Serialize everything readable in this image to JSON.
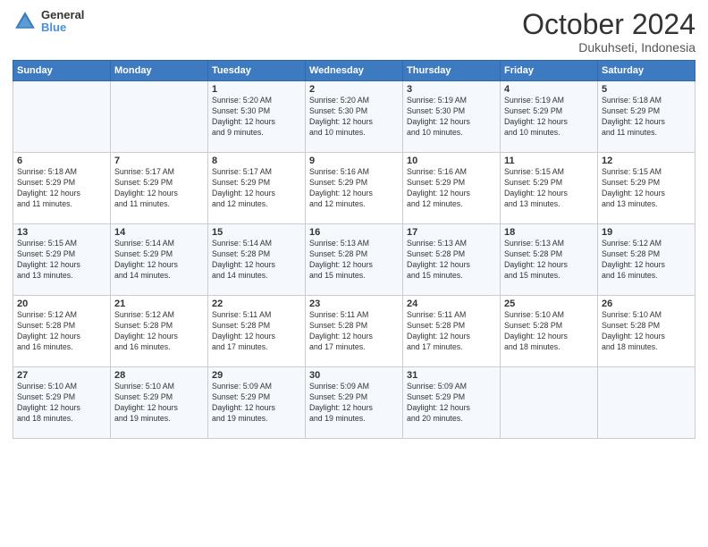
{
  "logo": {
    "line1": "General",
    "line2": "Blue"
  },
  "title": "October 2024",
  "subtitle": "Dukuhseti, Indonesia",
  "header_days": [
    "Sunday",
    "Monday",
    "Tuesday",
    "Wednesday",
    "Thursday",
    "Friday",
    "Saturday"
  ],
  "weeks": [
    [
      {
        "day": "",
        "info": ""
      },
      {
        "day": "",
        "info": ""
      },
      {
        "day": "1",
        "info": "Sunrise: 5:20 AM\nSunset: 5:30 PM\nDaylight: 12 hours\nand 9 minutes."
      },
      {
        "day": "2",
        "info": "Sunrise: 5:20 AM\nSunset: 5:30 PM\nDaylight: 12 hours\nand 10 minutes."
      },
      {
        "day": "3",
        "info": "Sunrise: 5:19 AM\nSunset: 5:30 PM\nDaylight: 12 hours\nand 10 minutes."
      },
      {
        "day": "4",
        "info": "Sunrise: 5:19 AM\nSunset: 5:29 PM\nDaylight: 12 hours\nand 10 minutes."
      },
      {
        "day": "5",
        "info": "Sunrise: 5:18 AM\nSunset: 5:29 PM\nDaylight: 12 hours\nand 11 minutes."
      }
    ],
    [
      {
        "day": "6",
        "info": "Sunrise: 5:18 AM\nSunset: 5:29 PM\nDaylight: 12 hours\nand 11 minutes."
      },
      {
        "day": "7",
        "info": "Sunrise: 5:17 AM\nSunset: 5:29 PM\nDaylight: 12 hours\nand 11 minutes."
      },
      {
        "day": "8",
        "info": "Sunrise: 5:17 AM\nSunset: 5:29 PM\nDaylight: 12 hours\nand 12 minutes."
      },
      {
        "day": "9",
        "info": "Sunrise: 5:16 AM\nSunset: 5:29 PM\nDaylight: 12 hours\nand 12 minutes."
      },
      {
        "day": "10",
        "info": "Sunrise: 5:16 AM\nSunset: 5:29 PM\nDaylight: 12 hours\nand 12 minutes."
      },
      {
        "day": "11",
        "info": "Sunrise: 5:15 AM\nSunset: 5:29 PM\nDaylight: 12 hours\nand 13 minutes."
      },
      {
        "day": "12",
        "info": "Sunrise: 5:15 AM\nSunset: 5:29 PM\nDaylight: 12 hours\nand 13 minutes."
      }
    ],
    [
      {
        "day": "13",
        "info": "Sunrise: 5:15 AM\nSunset: 5:29 PM\nDaylight: 12 hours\nand 13 minutes."
      },
      {
        "day": "14",
        "info": "Sunrise: 5:14 AM\nSunset: 5:29 PM\nDaylight: 12 hours\nand 14 minutes."
      },
      {
        "day": "15",
        "info": "Sunrise: 5:14 AM\nSunset: 5:28 PM\nDaylight: 12 hours\nand 14 minutes."
      },
      {
        "day": "16",
        "info": "Sunrise: 5:13 AM\nSunset: 5:28 PM\nDaylight: 12 hours\nand 15 minutes."
      },
      {
        "day": "17",
        "info": "Sunrise: 5:13 AM\nSunset: 5:28 PM\nDaylight: 12 hours\nand 15 minutes."
      },
      {
        "day": "18",
        "info": "Sunrise: 5:13 AM\nSunset: 5:28 PM\nDaylight: 12 hours\nand 15 minutes."
      },
      {
        "day": "19",
        "info": "Sunrise: 5:12 AM\nSunset: 5:28 PM\nDaylight: 12 hours\nand 16 minutes."
      }
    ],
    [
      {
        "day": "20",
        "info": "Sunrise: 5:12 AM\nSunset: 5:28 PM\nDaylight: 12 hours\nand 16 minutes."
      },
      {
        "day": "21",
        "info": "Sunrise: 5:12 AM\nSunset: 5:28 PM\nDaylight: 12 hours\nand 16 minutes."
      },
      {
        "day": "22",
        "info": "Sunrise: 5:11 AM\nSunset: 5:28 PM\nDaylight: 12 hours\nand 17 minutes."
      },
      {
        "day": "23",
        "info": "Sunrise: 5:11 AM\nSunset: 5:28 PM\nDaylight: 12 hours\nand 17 minutes."
      },
      {
        "day": "24",
        "info": "Sunrise: 5:11 AM\nSunset: 5:28 PM\nDaylight: 12 hours\nand 17 minutes."
      },
      {
        "day": "25",
        "info": "Sunrise: 5:10 AM\nSunset: 5:28 PM\nDaylight: 12 hours\nand 18 minutes."
      },
      {
        "day": "26",
        "info": "Sunrise: 5:10 AM\nSunset: 5:28 PM\nDaylight: 12 hours\nand 18 minutes."
      }
    ],
    [
      {
        "day": "27",
        "info": "Sunrise: 5:10 AM\nSunset: 5:29 PM\nDaylight: 12 hours\nand 18 minutes."
      },
      {
        "day": "28",
        "info": "Sunrise: 5:10 AM\nSunset: 5:29 PM\nDaylight: 12 hours\nand 19 minutes."
      },
      {
        "day": "29",
        "info": "Sunrise: 5:09 AM\nSunset: 5:29 PM\nDaylight: 12 hours\nand 19 minutes."
      },
      {
        "day": "30",
        "info": "Sunrise: 5:09 AM\nSunset: 5:29 PM\nDaylight: 12 hours\nand 19 minutes."
      },
      {
        "day": "31",
        "info": "Sunrise: 5:09 AM\nSunset: 5:29 PM\nDaylight: 12 hours\nand 20 minutes."
      },
      {
        "day": "",
        "info": ""
      },
      {
        "day": "",
        "info": ""
      }
    ]
  ]
}
